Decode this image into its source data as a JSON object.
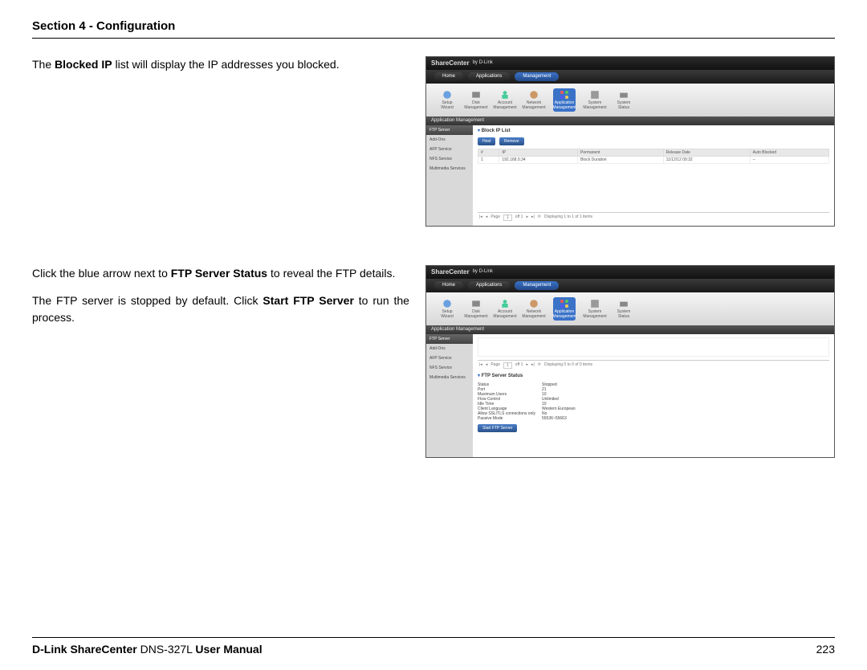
{
  "header": {
    "section": "Section 4 - Configuration"
  },
  "para1_a": "The ",
  "para1_b": "Blocked IP",
  "para1_c": " list will display the IP addresses you blocked.",
  "para2_a": "Click the blue arrow next to ",
  "para2_b": "FTP Server Status",
  "para2_c": " to reveal the FTP details.",
  "para3_a": "The FTP server is stopped by default. Click ",
  "para3_b": "Start FTP Server",
  "para3_c": " to run the process.",
  "brand": "ShareCenter",
  "brand_sub": "by D-Link",
  "nav": {
    "home": "Home",
    "apps": "Applications",
    "mgmt": "Management"
  },
  "icons": {
    "setup": "Setup Wizard",
    "disk": "Disk Management",
    "account": "Account Management",
    "network": "Network Management",
    "appmgmt": "Application Management",
    "sysmgmt": "System Management",
    "systatus": "System Status"
  },
  "panel": {
    "appmgmt": "Application Management"
  },
  "side": {
    "ftp": "FTP Server",
    "addons": "Add-Ons",
    "aft": "AFP Service",
    "nfs": "NFS Service",
    "mm": "Multimedia Services"
  },
  "shot1": {
    "title": "Block IP List",
    "btn_host": "Host",
    "btn_remove": "Remove",
    "cols": {
      "n": "#",
      "ip": "IP",
      "perm": "Permanent",
      "release": "Release Date",
      "auto": "Auto Blocked"
    },
    "row": {
      "n": "1",
      "ip": "192.168.0.34",
      "perm": "Block Duration",
      "release": "11/12/12 09:32",
      "auto": "--"
    },
    "pager": {
      "page": "Page",
      "num": "1",
      "text": "off 1",
      "disp": "Displaying 1 to 1 of 1 items"
    }
  },
  "shot2": {
    "empty_pager": "Displaying 0 to 0 of 0 items",
    "status_title": "FTP Server Status",
    "status": {
      "k1": "Status",
      "v1": "Stopped",
      "k2": "Port",
      "v2": "21",
      "k3": "Maximum Users",
      "v3": "10",
      "k4": "Flow Control",
      "v4": "Unlimited",
      "k5": "Idle Time",
      "v5": "10",
      "k6": "Client Language",
      "v6": "Western European",
      "k7": "Allow SSL/TLS connections only",
      "v7": "No",
      "k8": "Passive Mode",
      "v8": "55536~55663"
    },
    "start_btn": "Start FTP Server"
  },
  "footer": {
    "left_a": "D-Link ShareCenter ",
    "left_b": "DNS-327L ",
    "left_c": "User Manual",
    "page": "223"
  }
}
